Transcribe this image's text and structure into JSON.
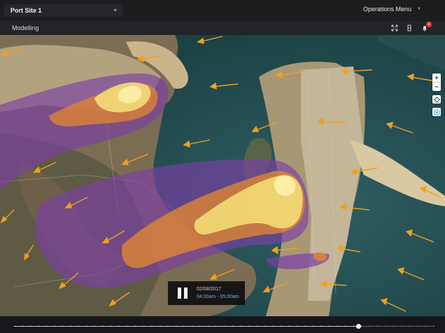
{
  "header": {
    "site_selector": {
      "selected": "Port Site 1"
    },
    "operations_menu": {
      "label": "Operations Menu"
    }
  },
  "subheader": {
    "title": "Modelling",
    "notifications": {
      "count": "2"
    }
  },
  "map": {
    "zoom_in_label": "+",
    "zoom_out_label": "−"
  },
  "player": {
    "date": "02/08/2017",
    "time_range": "04:00am - 05:00am"
  },
  "timeline": {
    "progress": 0.82,
    "tick_count": 52
  },
  "colors": {
    "plume_outer": "#7b3fa6",
    "plume_mid": "#e2862f",
    "plume_core": "#f6e27a",
    "wind_arrow": "#f0a020",
    "accent_time": "#64b5f6",
    "notification_badge": "#e53935"
  }
}
